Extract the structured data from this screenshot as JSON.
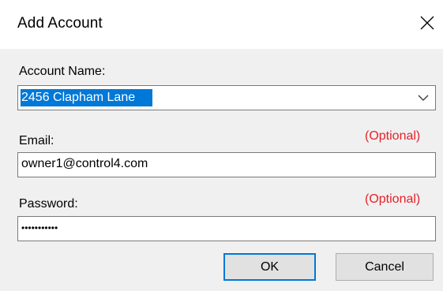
{
  "dialog": {
    "title": "Add Account",
    "close_icon": "close-icon"
  },
  "account_name": {
    "label": "Account Name:",
    "value": "2456 Clapham Lane",
    "dropdown_icon": "chevron-down-icon"
  },
  "email": {
    "label": "Email:",
    "optional_label": "(Optional)",
    "value": "owner1@control4.com"
  },
  "password": {
    "label": "Password:",
    "optional_label": "(Optional)",
    "masked_value": "•••••••••••"
  },
  "buttons": {
    "ok_label": "OK",
    "cancel_label": "Cancel"
  },
  "colors": {
    "optional_red": "#e8202a",
    "selection_blue": "#0078d7",
    "dialog_bg": "#f0f0f0"
  }
}
